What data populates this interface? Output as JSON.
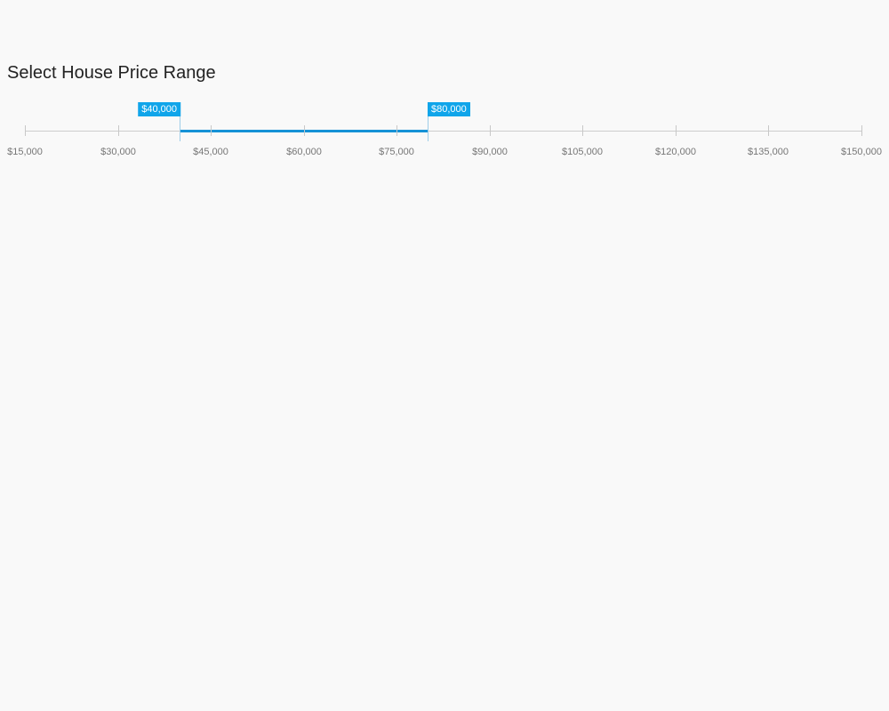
{
  "title": "Select House Price Range",
  "slider": {
    "min": 15000,
    "max": 150000,
    "step_labels": 15000,
    "from": 40000,
    "to": 80000,
    "from_label": "$40,000",
    "to_label": "$80,000",
    "ticks": [
      "$15,000",
      "$30,000",
      "$45,000",
      "$60,000",
      "$75,000",
      "$90,000",
      "$105,000",
      "$120,000",
      "$135,000",
      "$150,000"
    ],
    "accent_color": "#10a5ea",
    "bar_color": "#1592d6"
  }
}
